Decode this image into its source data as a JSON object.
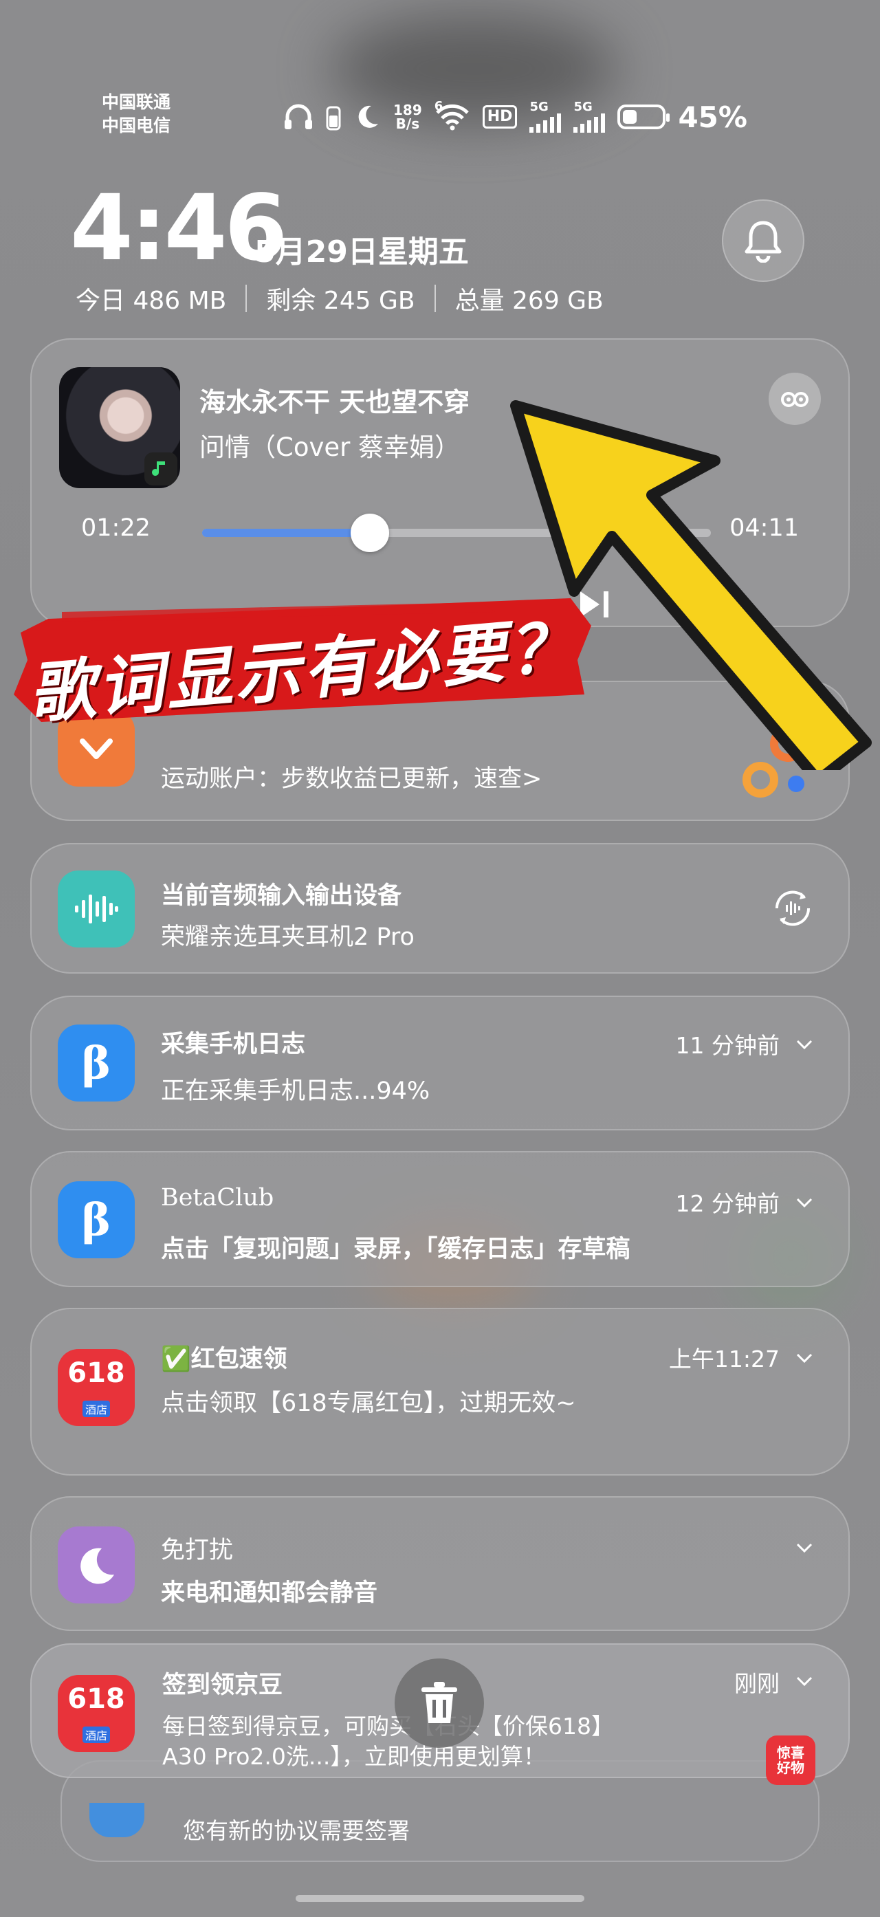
{
  "status_bar": {
    "carrier_1": "中国联通",
    "carrier_2": "中国电信",
    "net_speed_value": "189",
    "net_speed_unit": "B/s",
    "wifi_label": "6",
    "hd_label": "HD",
    "sim1_label": "5G",
    "sim2_label": "5G",
    "battery_percent_text": "45%",
    "battery_level": 0.45
  },
  "header": {
    "time": "4:46",
    "date": "5月29日星期五",
    "storage_today": "今日 486 MB",
    "storage_free": "剩余 245 GB",
    "storage_total": "总量 269 GB"
  },
  "music": {
    "title": "海水永不干 天也望不穿",
    "artist": "问情（Cover 蔡幸娟）",
    "elapsed": "01:22",
    "total": "04:11",
    "progress": 0.33
  },
  "overlay": {
    "caption": "歌词显示有必要？"
  },
  "notifications": [
    {
      "title": "",
      "body": "运动账户：步数收益已更新，速查>",
      "time": ""
    },
    {
      "title": "当前音频输入输出设备",
      "body": "荣耀亲选耳夹耳机2 Pro",
      "time": ""
    },
    {
      "title": "采集手机日志",
      "body": "正在采集手机日志...94%",
      "time": "11 分钟前"
    },
    {
      "title": "BetaClub",
      "body": "点击「复现问题」录屏，「缓存日志」存草稿",
      "time": "12 分钟前"
    },
    {
      "title": "✅红包速领",
      "body": "点击领取【618专属红包】，过期无效~",
      "time": "上午11:27"
    },
    {
      "title": "免打扰",
      "body": "来电和通知都会静音",
      "time": ""
    },
    {
      "title": "签到领京豆",
      "body_line1": "每日签到得京豆，可购买【石头【价保618】",
      "body_line2": "A30 Pro2.0洗...】，立即使用更划算！",
      "time": "刚刚"
    },
    {
      "title": "",
      "body": "您有新的协议需要签署",
      "time": ""
    }
  ],
  "icons": {
    "beta_glyph": "β",
    "app_618": "618",
    "app_618_sub": "酒店",
    "badge_text_1": "惊喜",
    "badge_text_2": "好物"
  },
  "colors": {
    "progress": "#5a8ee8",
    "banner_red": "#d8191a",
    "arrow_yellow": "#f7d21c",
    "sport_orange": "#f07a3a",
    "audio_teal": "#3fc1b8",
    "beta_blue": "#2f8ef0",
    "dnd_purple": "#a77ad0",
    "jd_red": "#e8333a"
  }
}
